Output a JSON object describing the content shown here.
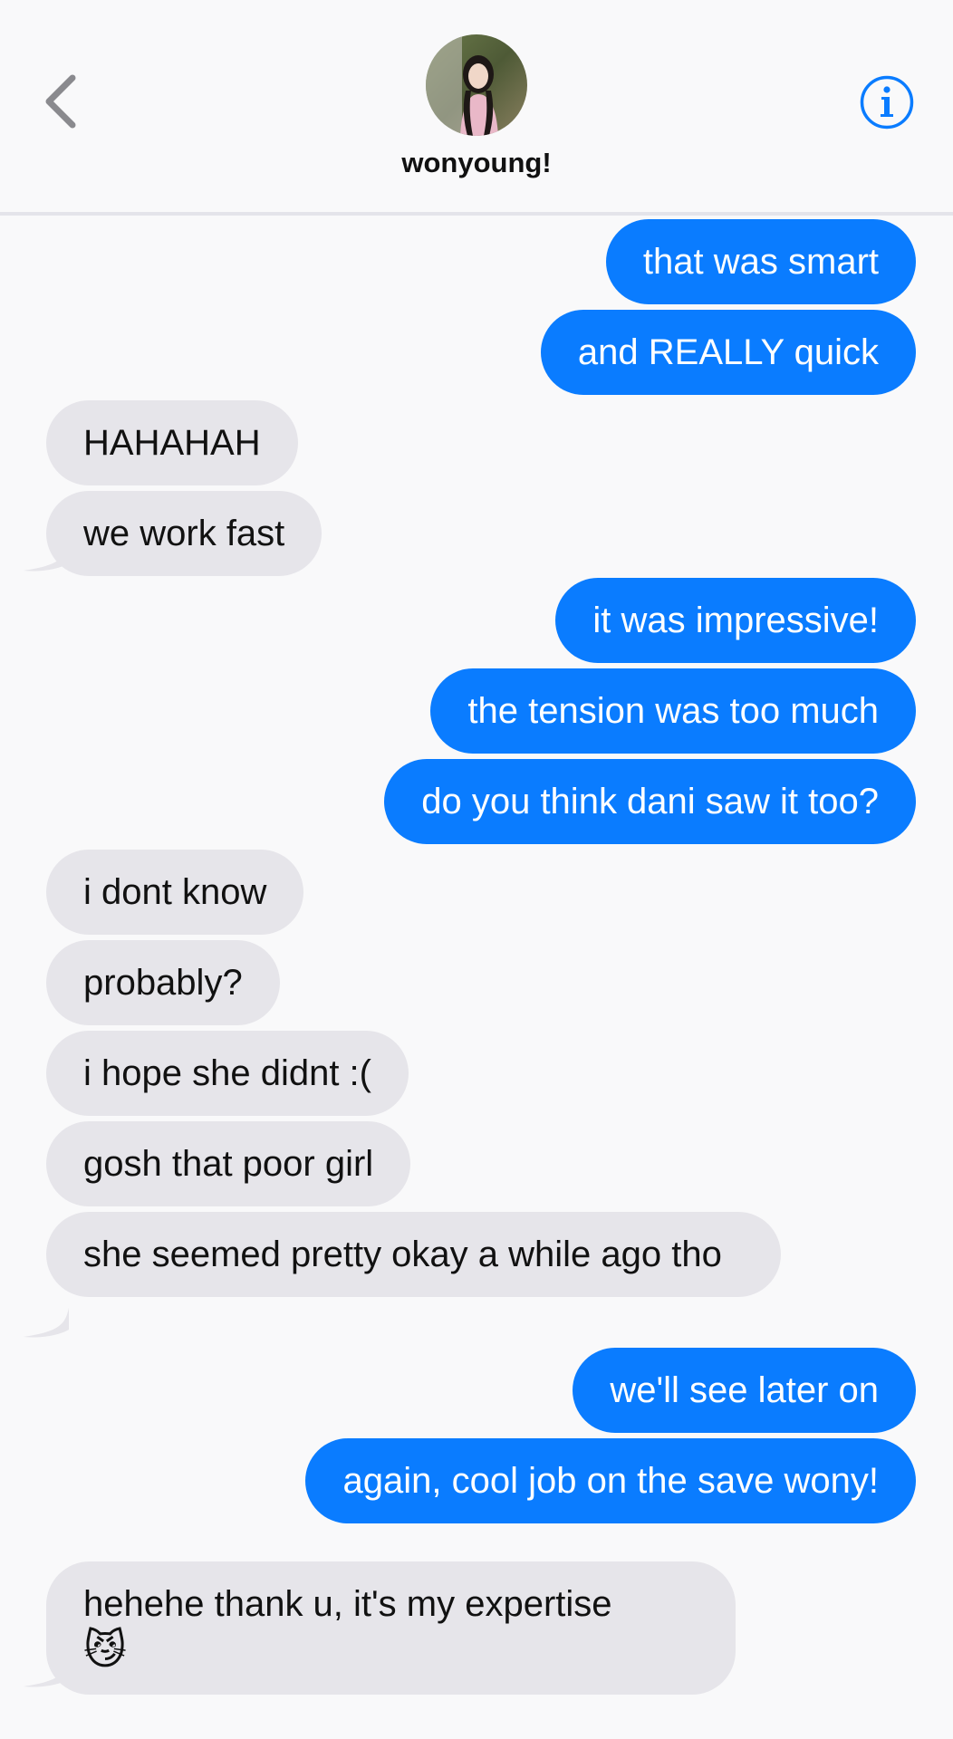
{
  "header": {
    "contact_name": "wonyoung!",
    "back_icon": "chevron-left-icon",
    "info_icon": "info-icon",
    "accent_color": "#0a7cff"
  },
  "messages": [
    {
      "from": "me",
      "text": "that was smart"
    },
    {
      "from": "me",
      "text": "and REALLY quick"
    },
    {
      "from": "them",
      "text": "HAHAHAH"
    },
    {
      "from": "them",
      "text": "we work fast"
    },
    {
      "from": "me",
      "text": "it was impressive!"
    },
    {
      "from": "me",
      "text": "the tension was too much"
    },
    {
      "from": "me",
      "text": "do you think dani saw it too?"
    },
    {
      "from": "them",
      "text": "i dont know"
    },
    {
      "from": "them",
      "text": "probably?"
    },
    {
      "from": "them",
      "text": "i hope she didnt :("
    },
    {
      "from": "them",
      "text": "gosh that poor girl"
    },
    {
      "from": "them",
      "text": "she seemed pretty okay a while ago tho"
    },
    {
      "from": "me",
      "text": "we'll see later on"
    },
    {
      "from": "me",
      "text": "again, cool job on the save wony!"
    },
    {
      "from": "them",
      "text": "hehehe thank u, it's my expertise",
      "emoji": "😼"
    }
  ]
}
